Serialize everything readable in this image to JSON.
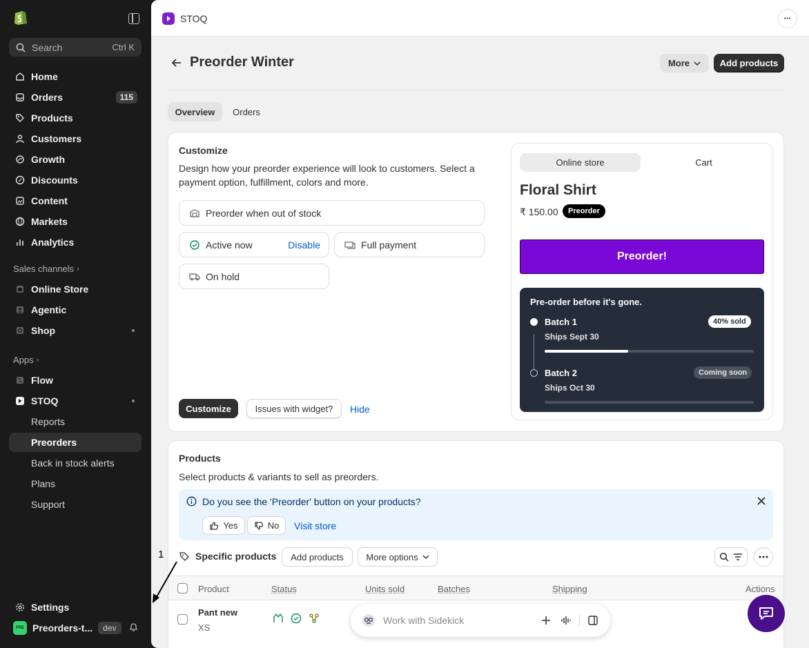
{
  "sidebar": {
    "search_placeholder": "Search",
    "search_shortcut": "Ctrl K",
    "items": [
      {
        "label": "Home"
      },
      {
        "label": "Orders",
        "badge": "115"
      },
      {
        "label": "Products"
      },
      {
        "label": "Customers"
      },
      {
        "label": "Growth"
      },
      {
        "label": "Discounts"
      },
      {
        "label": "Content"
      },
      {
        "label": "Markets"
      },
      {
        "label": "Analytics"
      }
    ],
    "sales_channels_label": "Sales channels",
    "channels": [
      {
        "label": "Online Store"
      },
      {
        "label": "Agentic"
      },
      {
        "label": "Shop"
      }
    ],
    "apps_label": "Apps",
    "apps": [
      {
        "label": "Flow"
      },
      {
        "label": "STOQ"
      }
    ],
    "stoq_subitems": [
      {
        "label": "Reports"
      },
      {
        "label": "Preorders"
      },
      {
        "label": "Back in stock alerts"
      },
      {
        "label": "Plans"
      },
      {
        "label": "Support"
      }
    ],
    "settings_label": "Settings",
    "store_name": "Preorders-t...",
    "store_avatar_text": "PRE",
    "dev_badge": "dev"
  },
  "topbar": {
    "app_name": "STOQ",
    "menu_glyph": "•••"
  },
  "page": {
    "title": "Preorder Winter",
    "more_label": "More",
    "add_products_label": "Add products",
    "tabs": [
      {
        "label": "Overview"
      },
      {
        "label": "Orders"
      }
    ]
  },
  "customize": {
    "title": "Customize",
    "description": "Design how your preorder experience will look to customers. Select a payment option, fulfillment, colors and more.",
    "option_stock": "Preorder when out of stock",
    "option_active": "Active now",
    "option_active_link": "Disable",
    "option_payment": "Full payment",
    "option_hold": "On hold",
    "customize_button": "Customize",
    "issues_button": "Issues with widget?",
    "hide_link": "Hide"
  },
  "preview": {
    "tab_online": "Online store",
    "tab_cart": "Cart",
    "product_title": "Floral Shirt",
    "price": "₹ 150.00",
    "badge": "Preorder",
    "button": "Preorder!",
    "batches_heading": "Pre-order before it's gone.",
    "batches": [
      {
        "name": "Batch 1",
        "ships": "Ships Sept 30",
        "status": "40% sold",
        "progress": 0.4
      },
      {
        "name": "Batch 2",
        "ships": "Ships Oct 30",
        "status": "Coming soon",
        "progress": 0
      }
    ]
  },
  "products": {
    "title": "Products",
    "description": "Select products & variants to sell as preorders.",
    "banner_question": "Do you see the 'Preorder' button on your products?",
    "banner_yes": "Yes",
    "banner_no": "No",
    "banner_link": "Visit store",
    "specific_label": "Specific products",
    "add_products": "Add products",
    "more_options": "More options",
    "columns": [
      "Product",
      "Status",
      "Units sold",
      "Batches",
      "Shipping",
      "Actions"
    ],
    "rows": [
      {
        "name": "Pant new",
        "variant": "XS"
      }
    ]
  },
  "sidekick": {
    "placeholder": "Work with Sidekick"
  },
  "annotation": {
    "number": "1"
  },
  "colors": {
    "accent": "#7a08d6",
    "sidebar_bg": "#1a1a1a",
    "link": "#005bd3"
  }
}
